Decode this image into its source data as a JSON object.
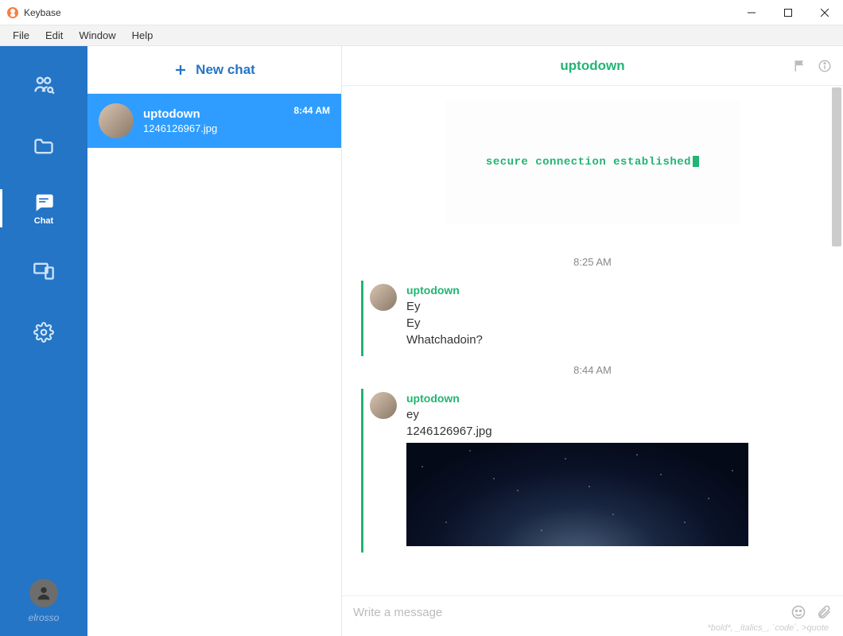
{
  "window": {
    "title": "Keybase"
  },
  "menubar": [
    "File",
    "Edit",
    "Window",
    "Help"
  ],
  "rail": {
    "chat_label": "Chat",
    "username": "elrosso"
  },
  "newchat_label": "New chat",
  "conversations": [
    {
      "name": "uptodown",
      "preview": "1246126967.jpg",
      "time": "8:44 AM"
    }
  ],
  "chat": {
    "header_title": "uptodown",
    "secure_text": "secure connection established",
    "timestamps": [
      "8:25 AM",
      "8:44 AM"
    ],
    "groups": [
      {
        "author": "uptodown",
        "lines": [
          "Ey",
          "Ey",
          "Whatchadoin?"
        ]
      },
      {
        "author": "uptodown",
        "lines": [
          "ey",
          "1246126967.jpg"
        ],
        "has_image": true
      }
    ]
  },
  "composer": {
    "placeholder": "Write a message",
    "hint": "*bold*, _italics_, `code`, >quote"
  }
}
